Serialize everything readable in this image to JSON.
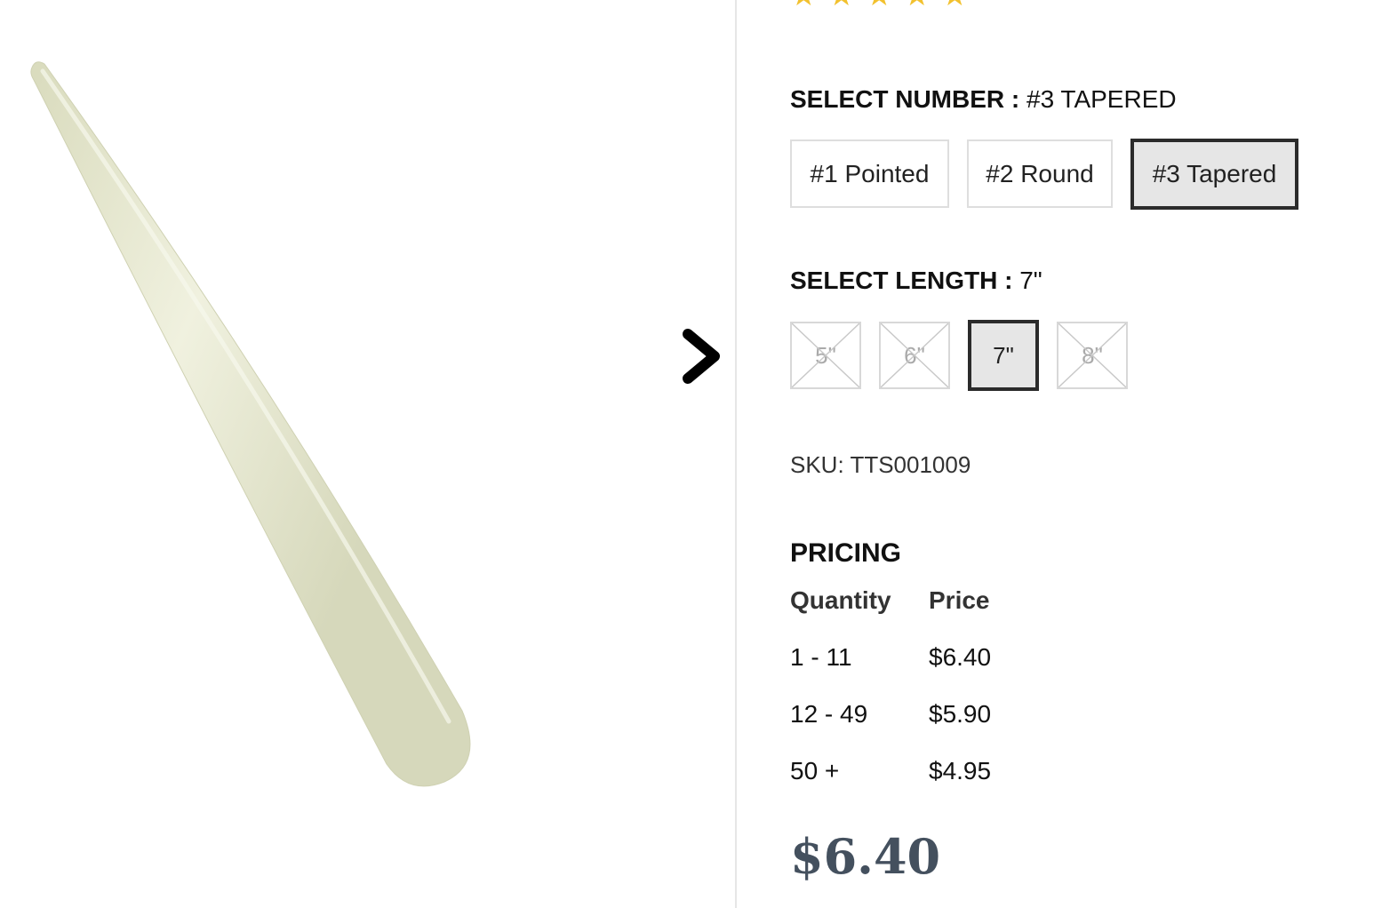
{
  "rating": {
    "stars": 5
  },
  "options": {
    "number": {
      "label": "SELECT NUMBER :",
      "selected_value": "#3 TAPERED",
      "choices": [
        {
          "label": "#1 Pointed",
          "selected": false
        },
        {
          "label": "#2 Round",
          "selected": false
        },
        {
          "label": "#3 Tapered",
          "selected": true
        }
      ]
    },
    "length": {
      "label": "SELECT LENGTH :",
      "selected_value": "7\"",
      "choices": [
        {
          "label": "5\"",
          "available": false
        },
        {
          "label": "6\"",
          "available": false
        },
        {
          "label": "7\"",
          "available": true,
          "selected": true
        },
        {
          "label": "8\"",
          "available": false
        }
      ]
    }
  },
  "sku": "SKU: TTS001009",
  "pricing": {
    "heading": "PRICING",
    "columns": [
      "Quantity",
      "Price"
    ],
    "rows": [
      {
        "quantity": "1 - 11",
        "price": "$6.40"
      },
      {
        "quantity": "12 - 49",
        "price": "$5.90"
      },
      {
        "quantity": "50 +",
        "price": "$4.95"
      }
    ]
  },
  "current_price": "$6.40",
  "colors": {
    "star": "#f2c12e",
    "selected_border": "#2b2b2b",
    "price": "#44505e",
    "product": "#e4e5cf"
  },
  "icons": {
    "next": "chevron-right-icon",
    "star": "star-icon"
  }
}
